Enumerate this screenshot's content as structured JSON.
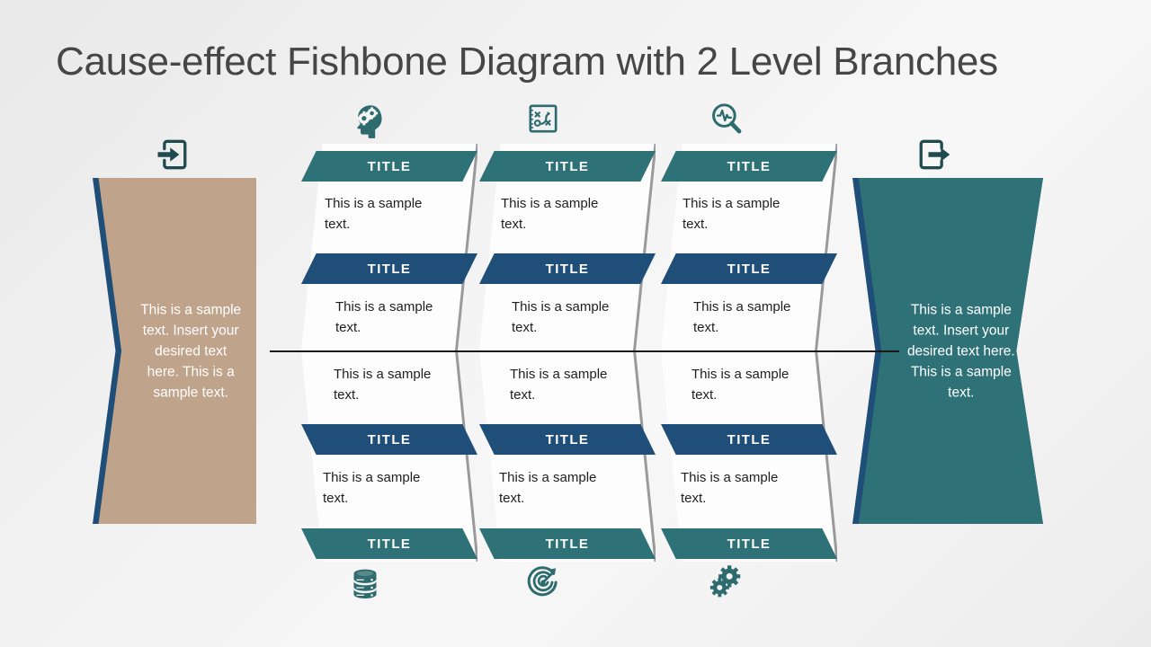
{
  "slide": {
    "title": "Cause-effect Fishbone Diagram with 2 Level Branches"
  },
  "colors": {
    "teal": "#2e7278",
    "blue": "#1f4e79",
    "tan": "#c0a38b",
    "spine": "#1a1a1a",
    "title_text": "#464646",
    "body_text": "#1f1f1f",
    "background": "#f2f2f2"
  },
  "left_block": {
    "label": "cause-input-block",
    "text": "This is a sample text. Insert your desired text here. This is a sample text.",
    "fill": "#c0a38b"
  },
  "right_block": {
    "label": "effect-output-block",
    "text": "This is a sample text. Insert your desired text here. This is a sample text.",
    "fill": "#2e7278"
  },
  "icons": {
    "input": "arrow-into-box-icon",
    "output": "arrow-out-of-box-icon",
    "top": [
      "head-with-gears-icon",
      "strategy-board-icon",
      "magnifier-pulse-icon"
    ],
    "bottom": [
      "database-stack-icon",
      "target-dart-icon",
      "two-gears-icon"
    ]
  },
  "branches": [
    {
      "id": "branch-1",
      "top_icon": "head-with-gears-icon",
      "bottom_icon": "database-stack-icon",
      "rows": [
        {
          "kind": "title",
          "style": "teal",
          "text": "TITLE"
        },
        {
          "kind": "body",
          "text": "This is a sample text."
        },
        {
          "kind": "title",
          "style": "blue",
          "text": "TITLE"
        },
        {
          "kind": "body",
          "text": "This is a sample text."
        },
        {
          "kind": "body",
          "text": "This is a sample text."
        },
        {
          "kind": "title",
          "style": "blue",
          "text": "TITLE"
        },
        {
          "kind": "body",
          "text": "This is a sample text."
        },
        {
          "kind": "title",
          "style": "teal",
          "text": "TITLE"
        }
      ]
    },
    {
      "id": "branch-2",
      "top_icon": "strategy-board-icon",
      "bottom_icon": "target-dart-icon",
      "rows": [
        {
          "kind": "title",
          "style": "teal",
          "text": "TITLE"
        },
        {
          "kind": "body",
          "text": "This is a sample text."
        },
        {
          "kind": "title",
          "style": "blue",
          "text": "TITLE"
        },
        {
          "kind": "body",
          "text": "This is a sample text."
        },
        {
          "kind": "body",
          "text": "This is a sample text."
        },
        {
          "kind": "title",
          "style": "blue",
          "text": "TITLE"
        },
        {
          "kind": "body",
          "text": "This is a sample text."
        },
        {
          "kind": "title",
          "style": "teal",
          "text": "TITLE"
        }
      ]
    },
    {
      "id": "branch-3",
      "top_icon": "magnifier-pulse-icon",
      "bottom_icon": "two-gears-icon",
      "rows": [
        {
          "kind": "title",
          "style": "teal",
          "text": "TITLE"
        },
        {
          "kind": "body",
          "text": "This is a sample text."
        },
        {
          "kind": "title",
          "style": "blue",
          "text": "TITLE"
        },
        {
          "kind": "body",
          "text": "This is a sample text."
        },
        {
          "kind": "body",
          "text": "This is a sample text."
        },
        {
          "kind": "title",
          "style": "blue",
          "text": "TITLE"
        },
        {
          "kind": "body",
          "text": "This is a sample text."
        },
        {
          "kind": "title",
          "style": "teal",
          "text": "TITLE"
        }
      ]
    }
  ]
}
